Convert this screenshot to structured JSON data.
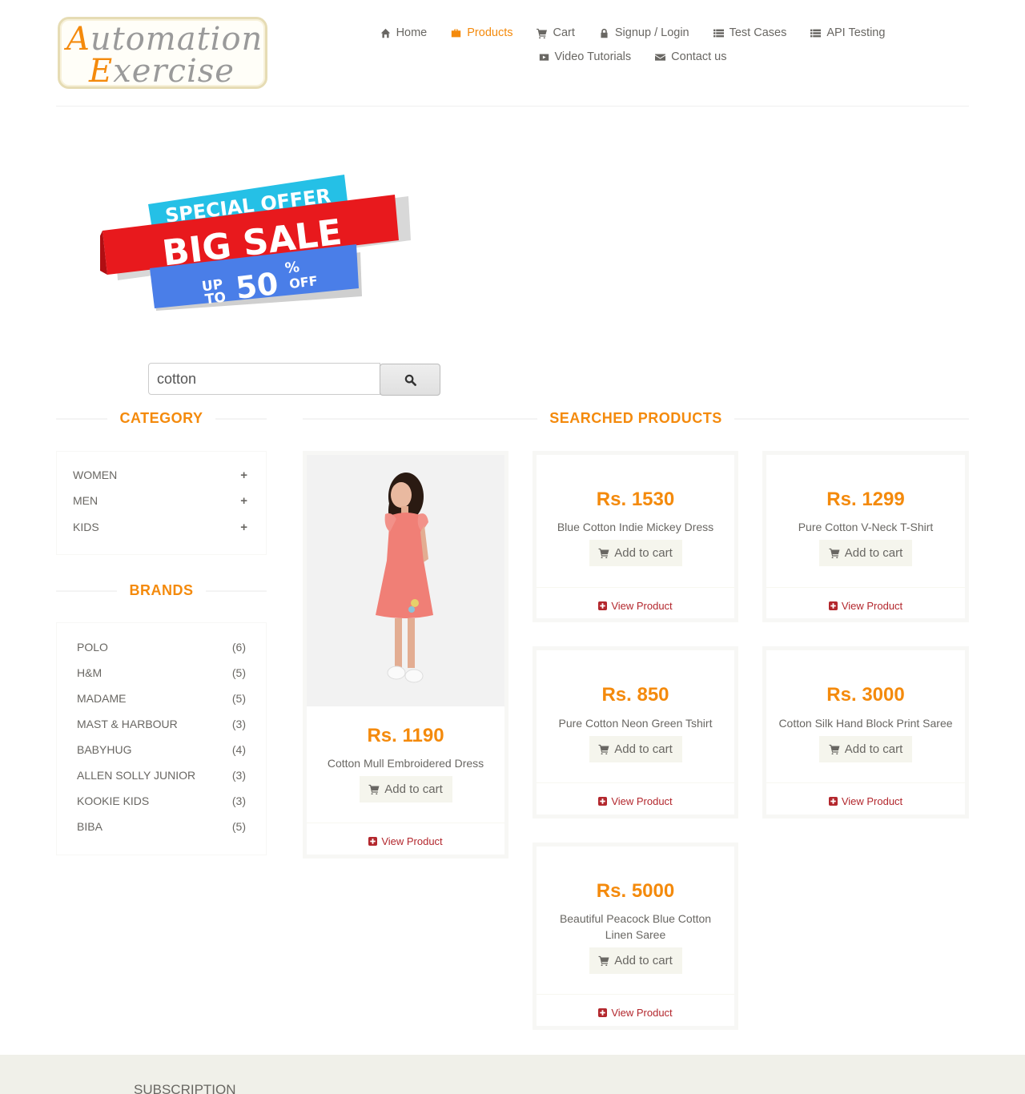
{
  "nav": {
    "row1": [
      {
        "label": "Home",
        "icon": "home-icon"
      },
      {
        "label": "Products",
        "icon": "briefcase-icon",
        "active": true
      },
      {
        "label": "Cart",
        "icon": "cart-icon"
      },
      {
        "label": "Signup / Login",
        "icon": "lock-icon"
      },
      {
        "label": "Test Cases",
        "icon": "list-icon"
      },
      {
        "label": "API Testing",
        "icon": "list-icon"
      }
    ],
    "row2": [
      {
        "label": "Video Tutorials",
        "icon": "youtube-icon"
      },
      {
        "label": "Contact us",
        "icon": "envelope-icon"
      }
    ]
  },
  "logo": {
    "cap1": "A",
    "rest1": "utomation",
    "cap2": "E",
    "rest2": "xercise"
  },
  "banner": {
    "line1": "SPECIAL OFFER",
    "line2": "BIG SALE",
    "up": "UP",
    "to": "TO",
    "pct": "50",
    "pctsign": "%",
    "off": "OFF"
  },
  "search": {
    "value": "cotton"
  },
  "category": {
    "title": "CATEGORY",
    "items": [
      "WOMEN",
      "MEN",
      "KIDS"
    ]
  },
  "brands": {
    "title": "BRANDS",
    "items": [
      {
        "name": "POLO",
        "count": "(6)"
      },
      {
        "name": "H&M",
        "count": "(5)"
      },
      {
        "name": "MADAME",
        "count": "(5)"
      },
      {
        "name": "MAST & HARBOUR",
        "count": "(3)"
      },
      {
        "name": "BABYHUG",
        "count": "(4)"
      },
      {
        "name": "ALLEN SOLLY JUNIOR",
        "count": "(3)"
      },
      {
        "name": "KOOKIE KIDS",
        "count": "(3)"
      },
      {
        "name": "BIBA",
        "count": "(5)"
      }
    ]
  },
  "products": {
    "title": "SEARCHED PRODUCTS",
    "add_label": "Add to cart",
    "view_label": "View Product",
    "items": [
      {
        "price": "Rs. 1190",
        "name": "Cotton Mull Embroidered Dress"
      },
      {
        "price": "Rs. 1530",
        "name": "Blue Cotton Indie Mickey Dress"
      },
      {
        "price": "Rs. 1299",
        "name": "Pure Cotton V-Neck T-Shirt"
      },
      {
        "price": "Rs. 850",
        "name": "Pure Cotton Neon Green Tshirt"
      },
      {
        "price": "Rs. 3000",
        "name": "Cotton Silk Hand Block Print Saree"
      },
      {
        "price": "Rs. 5000",
        "name": "Beautiful Peacock Blue Cotton Linen Saree"
      }
    ]
  },
  "footer": {
    "subscription": "SUBSCRIPTION"
  },
  "colors": {
    "accent": "#f48a0c",
    "view_link": "#b3272d",
    "text": "#696763"
  }
}
